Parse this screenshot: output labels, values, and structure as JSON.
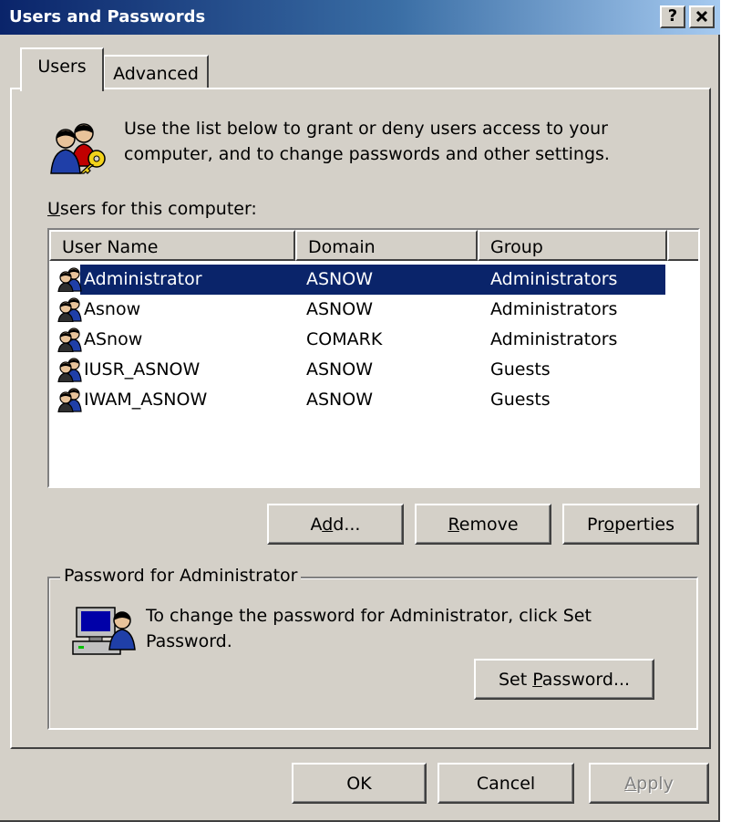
{
  "window": {
    "title": "Users and Passwords",
    "help_button": "?",
    "close_button": "✕"
  },
  "tabs": [
    {
      "label": "Users",
      "active": true
    },
    {
      "label": "Advanced",
      "active": false
    }
  ],
  "intro": {
    "line1": "Use the list below to grant or deny users access to your",
    "line2": "computer, and to change passwords and other settings."
  },
  "users_list": {
    "label": "Users for this computer:",
    "columns": [
      "User Name",
      "Domain",
      "Group"
    ],
    "rows": [
      {
        "name": "Administrator",
        "domain": "ASNOW",
        "group": "Administrators",
        "selected": true
      },
      {
        "name": "Asnow",
        "domain": "ASNOW",
        "group": "Administrators",
        "selected": false
      },
      {
        "name": "ASnow",
        "domain": "COMARK",
        "group": "Administrators",
        "selected": false
      },
      {
        "name": "IUSR_ASNOW",
        "domain": "ASNOW",
        "group": "Guests",
        "selected": false
      },
      {
        "name": "IWAM_ASNOW",
        "domain": "ASNOW",
        "group": "Guests",
        "selected": false
      }
    ]
  },
  "list_buttons": {
    "add": "Add...",
    "remove": "Remove",
    "properties": "Properties"
  },
  "password_group": {
    "label": "Password for Administrator",
    "line1": "To change the password for Administrator, click Set",
    "line2": "Password.",
    "set_password": "Set Password..."
  },
  "footer": {
    "ok": "OK",
    "cancel": "Cancel",
    "apply": "Apply"
  },
  "colors": {
    "selection": "#0a246a",
    "face": "#d4d0c8",
    "title_start": "#0a246a",
    "title_end": "#a6caf0"
  },
  "icons": {
    "intro": "users-key-icon",
    "row": "user-icon",
    "password": "computer-user-icon"
  }
}
